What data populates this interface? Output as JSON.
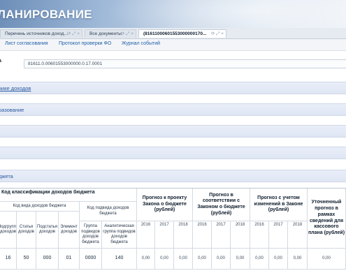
{
  "header": {
    "title": "ЛАНИРОВАНИЕ"
  },
  "tabs": [
    {
      "label": "Перечень источников доход...",
      "controls": "⟳ ⤢ ×"
    },
    {
      "label": "Все документы",
      "controls": "⟳ ⤢ ×"
    },
    {
      "label": "(81611000601553000000170...",
      "controls": "⟳ ⤢ ×"
    }
  ],
  "subnav": {
    "approval": "Лист согласования",
    "protocol": "Протокол проверки ФО",
    "events": "Журнал событий"
  },
  "record": {
    "label": "а",
    "id_value": "81611.0.00601553000000.0.17.0001"
  },
  "sections": [
    {
      "label": "чике доходов"
    },
    {
      "label": "разование"
    },
    {
      "label": ""
    },
    {
      "label": ""
    },
    {
      "label": "джета"
    }
  ],
  "table": {
    "group_header": "Код классификации доходов бюджета",
    "sub_kind": "Код вида доходов бюджета",
    "sub_subkind": "Код подвида доходов бюджета",
    "col_subgroup": "Подгруппа доходов",
    "col_article": "Статья доходов",
    "col_subarticle": "Подстатья доходов",
    "col_element": "Элемент доходов",
    "col_subkind_group": "Группа подвидов доходов бюджета",
    "col_analytic": "Аналитическая группа подвидов доходов бюджета",
    "forecast_law": "Прогноз к проекту Закона о бюджете (рублей)",
    "forecast_match": "Прогноз в соответствии с Законом о бюджете (рублей)",
    "forecast_changes": "Прогноз с учетом изменений в Законе (рублей)",
    "forecast_refined": "Уточненный прогноз в рамках сведений для кассового плана (рублей)",
    "years": [
      "2016",
      "2017",
      "2018"
    ],
    "row": {
      "subgroup": "16",
      "article": "50",
      "subarticle": "000",
      "element": "01",
      "subkind_group": "0000",
      "analytic": "140",
      "law": [
        "0,00",
        "0,00",
        "0,00"
      ],
      "match": [
        "0,00",
        "0,00",
        "0,00"
      ],
      "changes": [
        "0,00",
        "0,00",
        "0,00"
      ],
      "refined": "0,00"
    }
  }
}
